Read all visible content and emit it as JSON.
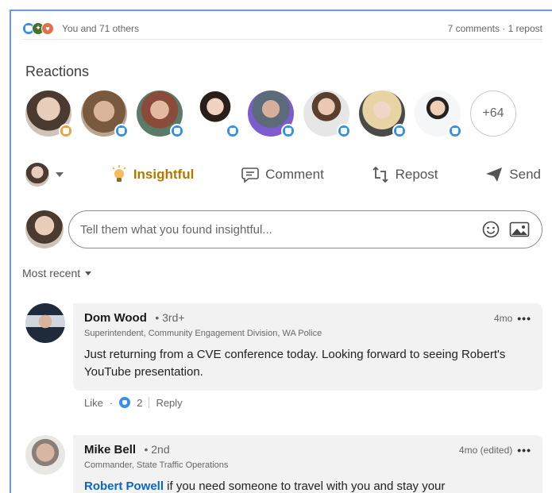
{
  "social": {
    "reacted_text": "You and 71 others",
    "counts_text": "7 comments · 1 repost"
  },
  "reactions": {
    "title": "Reactions",
    "more_count": "+64"
  },
  "actions": {
    "insightful": "Insightful",
    "comment": "Comment",
    "repost": "Repost",
    "send": "Send"
  },
  "composer": {
    "placeholder": "Tell them what you found insightful..."
  },
  "sort": {
    "label": "Most recent"
  },
  "comments": [
    {
      "name": "Dom Wood",
      "degree": "• 3rd+",
      "time": "4mo",
      "title": "Superintendent, Community Engagement Division, WA Police",
      "text": "Just returning from a CVE conference today. Looking forward to seeing Robert's YouTube presentation.",
      "like_label": "Like",
      "like_count": "2",
      "reply_label": "Reply"
    },
    {
      "name": "Mike Bell",
      "degree": "• 2nd",
      "time": "4mo (edited)",
      "title": "Commander, State Traffic Operations",
      "text_link": "Robert Powell",
      "text_rest": " if you need someone to travel with you and stay your"
    }
  ],
  "colors": {
    "accent": "#0a66c2",
    "like": "#378fe9",
    "insightful": "#b57700",
    "bubble": "#f2f2f2"
  }
}
